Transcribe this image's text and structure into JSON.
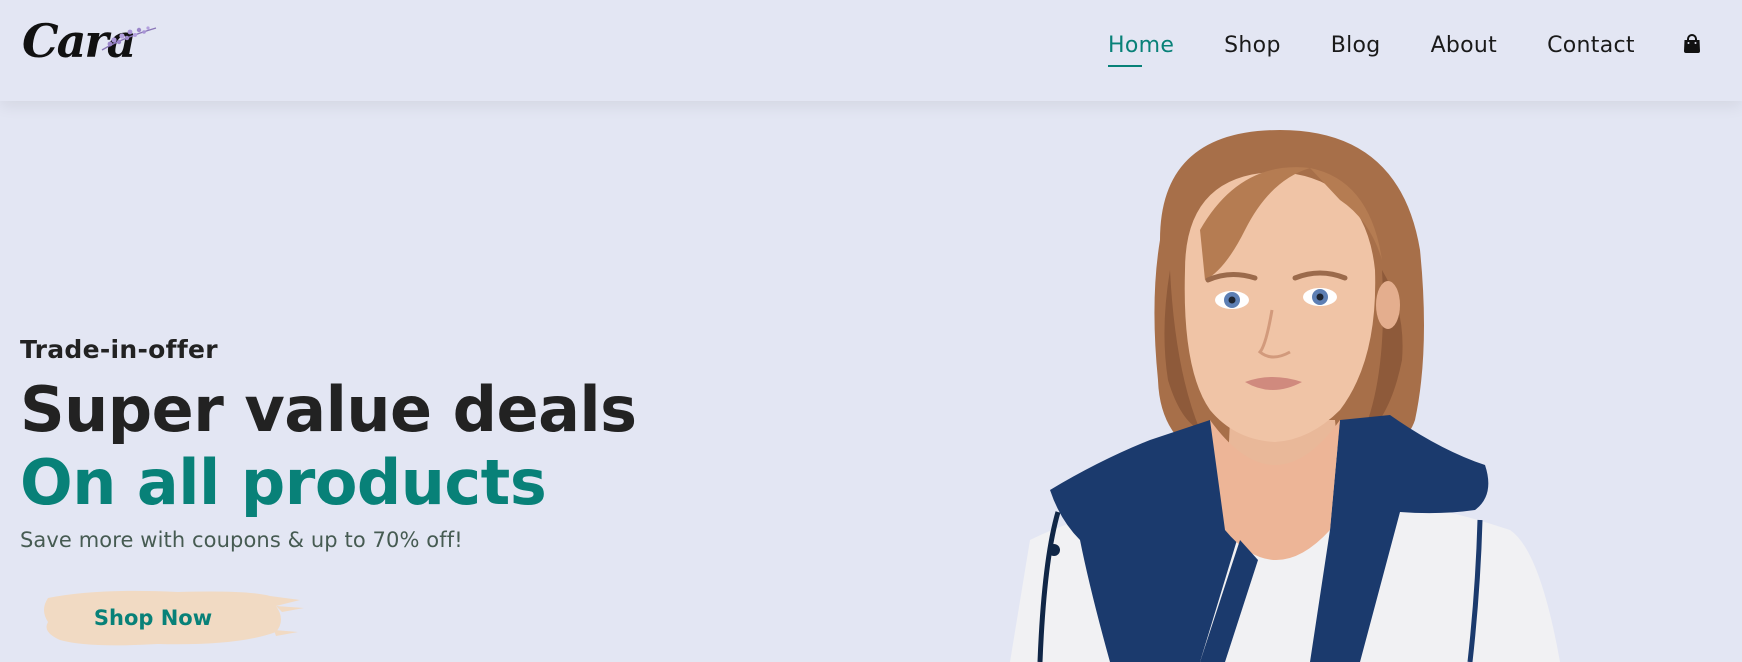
{
  "header": {
    "logo_text": "Cara",
    "nav": [
      {
        "label": "Home",
        "active": true
      },
      {
        "label": "Shop",
        "active": false
      },
      {
        "label": "Blog",
        "active": false
      },
      {
        "label": "About",
        "active": false
      },
      {
        "label": "Contact",
        "active": false
      }
    ],
    "cart_icon": "shopping-bag-icon"
  },
  "hero": {
    "offer": "Trade-in-offer",
    "title": "Super value deals",
    "subtitle": "On all products",
    "description": "Save more with coupons & up to 70% off!",
    "button_label": "Shop Now",
    "image": "model-photo"
  },
  "colors": {
    "background": "#e3e6f3",
    "accent": "#088178",
    "button_bg": "#f1dac3",
    "text_dark": "#222222"
  }
}
